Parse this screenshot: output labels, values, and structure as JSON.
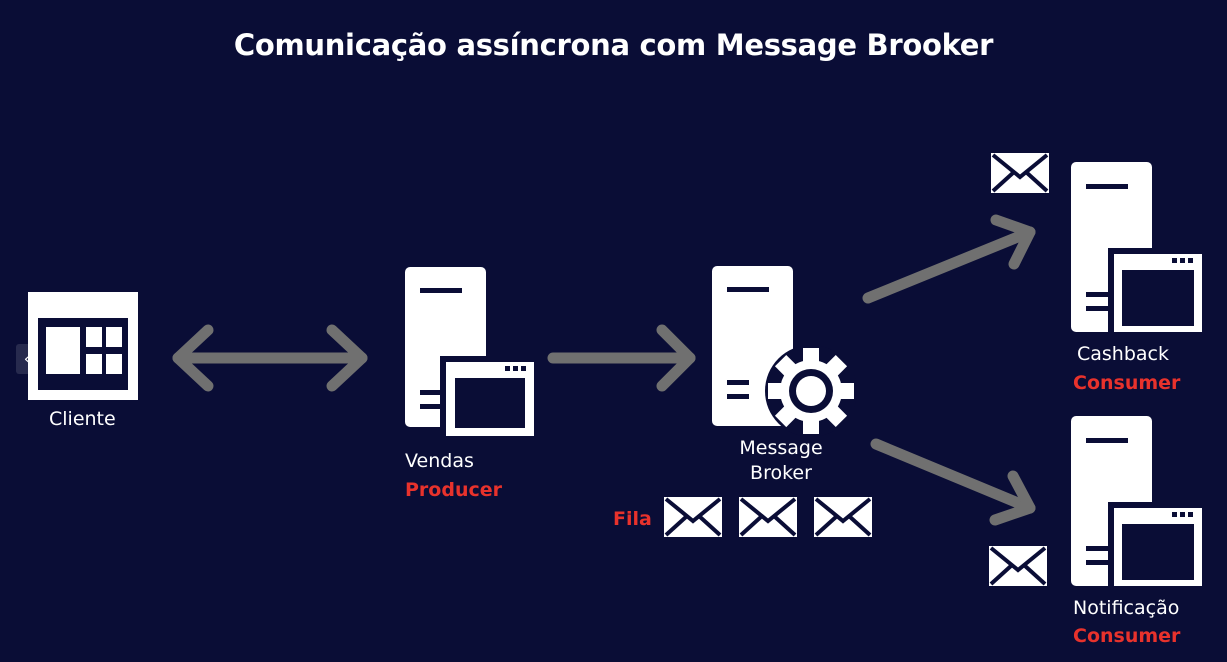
{
  "title": "Comunicação assíncrona com Message Brooker",
  "nodes": {
    "client": {
      "label": "Cliente"
    },
    "sales": {
      "label": "Vendas",
      "role": "Producer"
    },
    "broker": {
      "label_line1": "Message",
      "label_line2": "Broker",
      "queue_label": "Fila"
    },
    "cashback": {
      "label": "Cashback",
      "role": "Consumer"
    },
    "notification": {
      "label": "Notificação",
      "role": "Consumer"
    }
  },
  "controls": {
    "prev_glyph": "‹"
  },
  "colors": {
    "background": "#0a0d36",
    "arrow": "#707070",
    "icon": "#ffffff",
    "accent": "#e8322c"
  },
  "icons": [
    "browser-window-icon",
    "server-icon",
    "gear-icon",
    "envelope-icon",
    "double-arrow",
    "arrow"
  ]
}
